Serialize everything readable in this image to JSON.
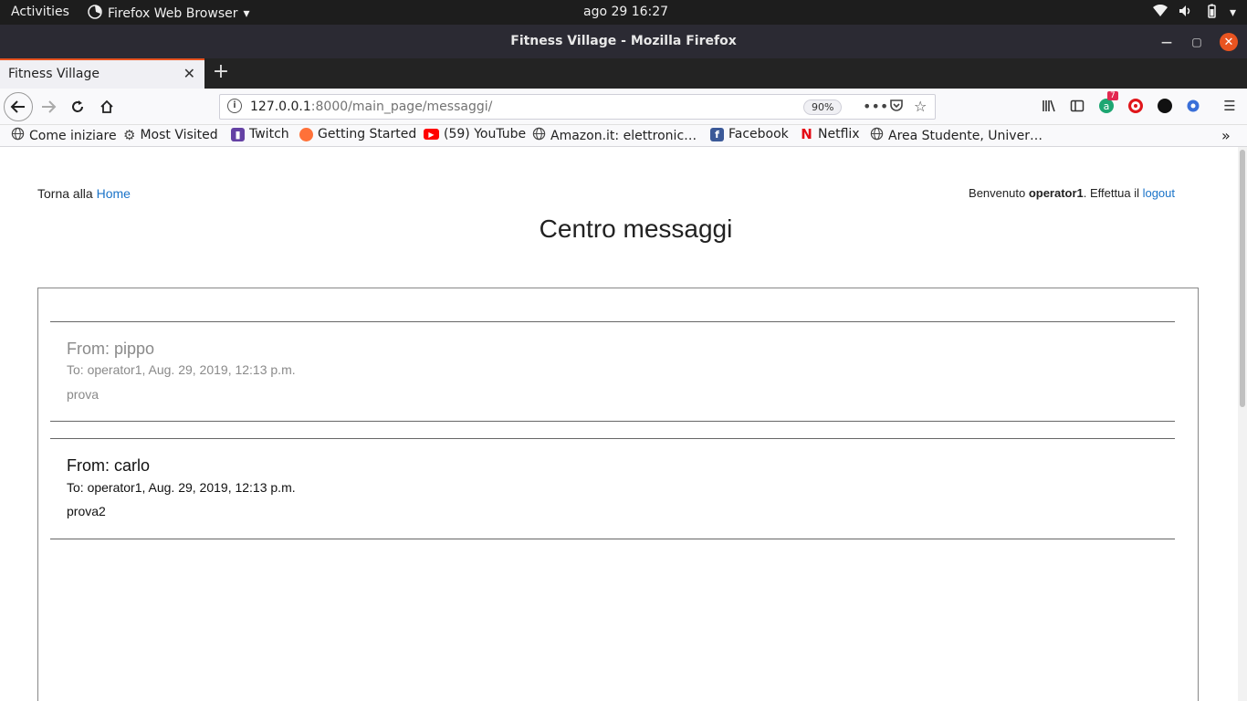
{
  "system": {
    "activities": "Activities",
    "app_menu": "Firefox Web Browser",
    "clock": "ago 29  16:27"
  },
  "window": {
    "title": "Fitness Village - Mozilla Firefox"
  },
  "tabs": [
    {
      "label": "Fitness Village",
      "active": true
    }
  ],
  "navbar": {
    "url_host": "127.0.0.1",
    "url_path": ":8000/main_page/messaggi/",
    "zoom": "90%",
    "badge_count": "7"
  },
  "bookmarks": [
    {
      "label": "Come iniziare",
      "icon": "globe-icon"
    },
    {
      "label": "Most Visited",
      "icon": "gear-icon"
    },
    {
      "label": "Twitch",
      "icon": "twitch-icon"
    },
    {
      "label": "Getting Started",
      "icon": "firefox-icon"
    },
    {
      "label": "(59) YouTube",
      "icon": "youtube-icon"
    },
    {
      "label": "Amazon.it: elettronic…",
      "icon": "globe-icon"
    },
    {
      "label": "Facebook",
      "icon": "facebook-icon"
    },
    {
      "label": "Netflix",
      "icon": "netflix-icon"
    },
    {
      "label": "Area Studente, Univer…",
      "icon": "globe-icon"
    }
  ],
  "page": {
    "back_prefix": "Torna alla ",
    "home_link": "Home",
    "welcome_prefix": "Benvenuto ",
    "username": "operator1",
    "welcome_mid": ". Effettua il ",
    "logout_link": "logout",
    "title": "Centro messaggi",
    "messages": [
      {
        "from": "From: pippo",
        "to": "To: operator1, Aug. 29, 2019, 12:13 p.m.",
        "body": "prova",
        "read": true
      },
      {
        "from": "From: carlo",
        "to": "To: operator1, Aug. 29, 2019, 12:13 p.m.",
        "body": "prova2",
        "read": false
      }
    ]
  },
  "colors": {
    "accent": "#e95420",
    "link": "#1a73c8",
    "read_text": "#8a8a8a"
  }
}
